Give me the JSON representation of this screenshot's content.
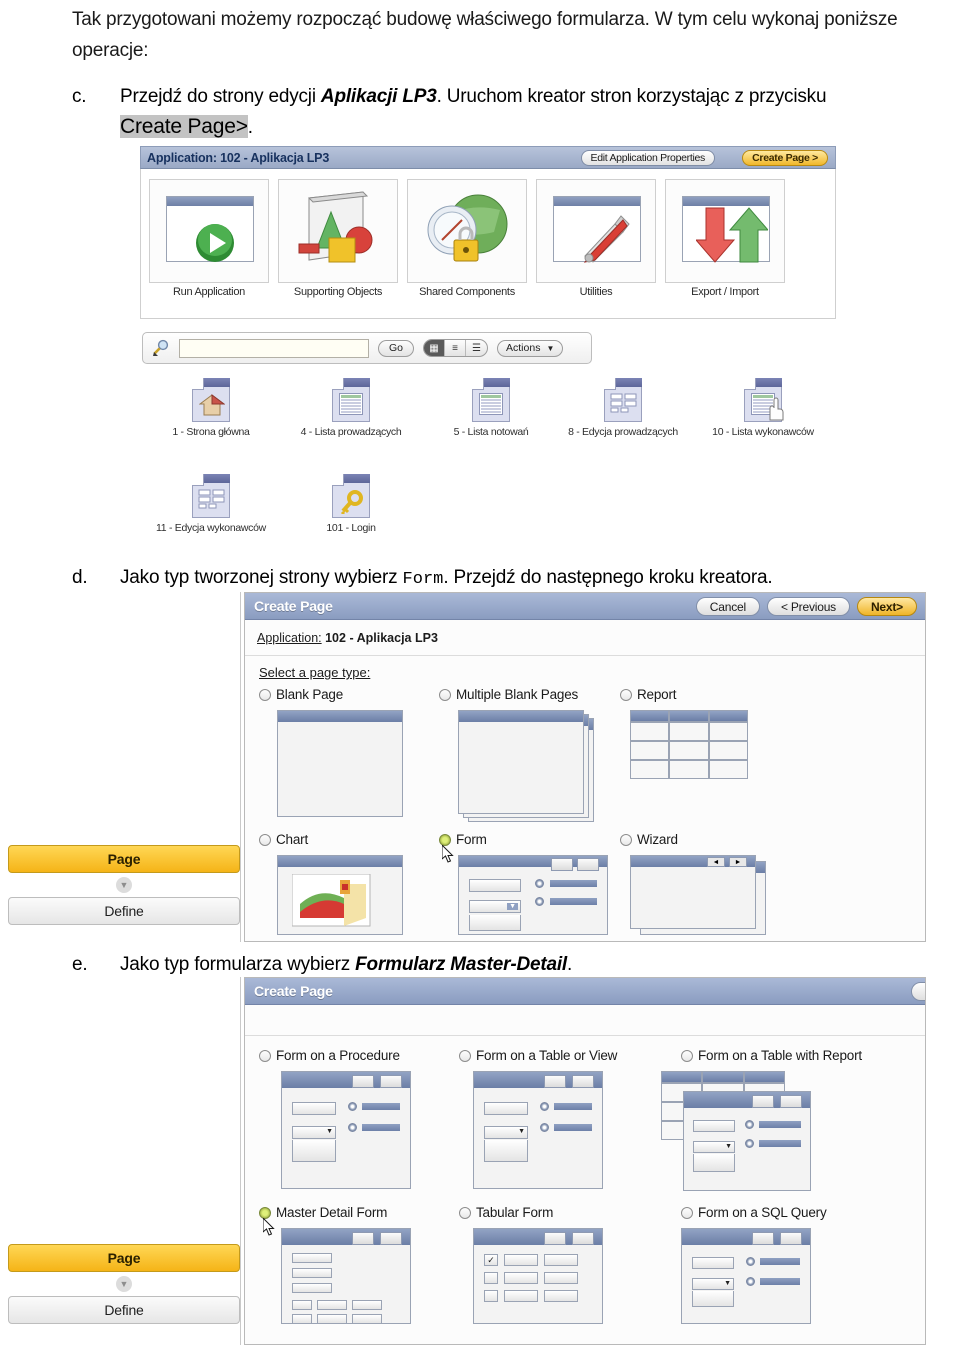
{
  "document": {
    "intro": "Tak przygotowani możemy rozpocząć budowę właściwego formularza. W tym celu wykonaj poniższe operacje:",
    "items": [
      {
        "marker": "c.",
        "text_1": "Przejdź do strony edycji ",
        "emph_1": "Aplikacji LP3",
        "text_2": ". Uruchom kreator stron korzystając z przycisku ",
        "highlight": "Create Page>",
        "text_3": "."
      },
      {
        "marker": "d.",
        "text_1": "Jako typ tworzonej strony wybierz ",
        "code": "Form",
        "text_2": ". Przejdź do następnego kroku kreatora."
      },
      {
        "marker": "e.",
        "text_1": "Jako typ formularza wybierz ",
        "emph_1": "Formularz Master-Detail",
        "text_2": "."
      }
    ]
  },
  "shot_app": {
    "header": {
      "title": "Application: 102 - Aplikacja LP3",
      "edit_properties_button": "Edit Application Properties",
      "create_page_button": "Create Page >"
    },
    "tiles": [
      {
        "label": "Run Application",
        "icon": "play-icon"
      },
      {
        "label": "Supporting Objects",
        "icon": "shapes-icon"
      },
      {
        "label": "Shared Components",
        "icon": "globe-lock-icon"
      },
      {
        "label": "Utilities",
        "icon": "tools-icon"
      },
      {
        "label": "Export / Import",
        "icon": "arrows-updown-icon"
      }
    ],
    "toolbar": {
      "search_icon": "magnifier-icon",
      "search_value": "",
      "search_placeholder": "",
      "go_button": "Go",
      "view_icons": [
        "grid-view-icon",
        "report-view-icon",
        "detail-view-icon"
      ],
      "view_selected": 0,
      "actions_button": "Actions",
      "actions_caret": "caret-down-icon"
    },
    "pages": [
      {
        "label": "1 - Strona główna",
        "icon": "page-home-icon"
      },
      {
        "label": "4 - Lista prowadzących",
        "icon": "page-report-icon"
      },
      {
        "label": "5 - Lista notowań",
        "icon": "page-report-icon"
      },
      {
        "label": "8 - Edycja prowadzących",
        "icon": "page-form-icon"
      },
      {
        "label": "10 - Lista wykonawców",
        "icon": "page-report-icon"
      },
      {
        "label": "11 - Edycja wykonawców",
        "icon": "page-form-icon"
      },
      {
        "label": "101 - Login",
        "icon": "page-key-icon"
      }
    ]
  },
  "shot_wizard_pagetype": {
    "header": {
      "title": "Create Page",
      "cancel_button": "Cancel",
      "previous_button": "< Previous",
      "next_button": "Next>"
    },
    "application_label": "Application:",
    "application_value": "102 - Aplikacja LP3",
    "legend": "Select a page type:",
    "options": [
      {
        "label": "Blank Page",
        "selected": false,
        "thumb": "blank-page-thumb"
      },
      {
        "label": "Multiple Blank Pages",
        "selected": false,
        "thumb": "multi-blank-thumb"
      },
      {
        "label": "Report",
        "selected": false,
        "thumb": "report-thumb"
      },
      {
        "label": "Chart",
        "selected": false,
        "thumb": "chart-thumb"
      },
      {
        "label": "Form",
        "selected": true,
        "thumb": "form-thumb"
      },
      {
        "label": "Wizard",
        "selected": false,
        "thumb": "wizard-thumb"
      }
    ],
    "rail": {
      "page_button": "Page",
      "chevron": "chevron-down-icon",
      "define_button": "Define"
    }
  },
  "shot_wizard_formtype": {
    "header": {
      "title": "Create Page"
    },
    "options": [
      {
        "label": "Form on a Procedure",
        "selected": false,
        "thumb": "form-thumb"
      },
      {
        "label": "Form on a Table or View",
        "selected": false,
        "thumb": "form-thumb"
      },
      {
        "label": "Form on a Table with Report",
        "selected": false,
        "thumb": "form-report-thumb"
      },
      {
        "label": "Master Detail Form",
        "selected": true,
        "thumb": "master-detail-thumb"
      },
      {
        "label": "Tabular Form",
        "selected": false,
        "thumb": "tabular-thumb"
      },
      {
        "label": "Form on a SQL Query",
        "selected": false,
        "thumb": "form-thumb"
      }
    ],
    "rail": {
      "page_button": "Page",
      "chevron": "chevron-down-icon",
      "define_button": "Define"
    }
  },
  "colors": {
    "header_blue": "#9aa9c6",
    "wizard_blue": "#8a9cc0",
    "gold": "#f0b72b",
    "highlight_gray": "#c3c3c3"
  }
}
